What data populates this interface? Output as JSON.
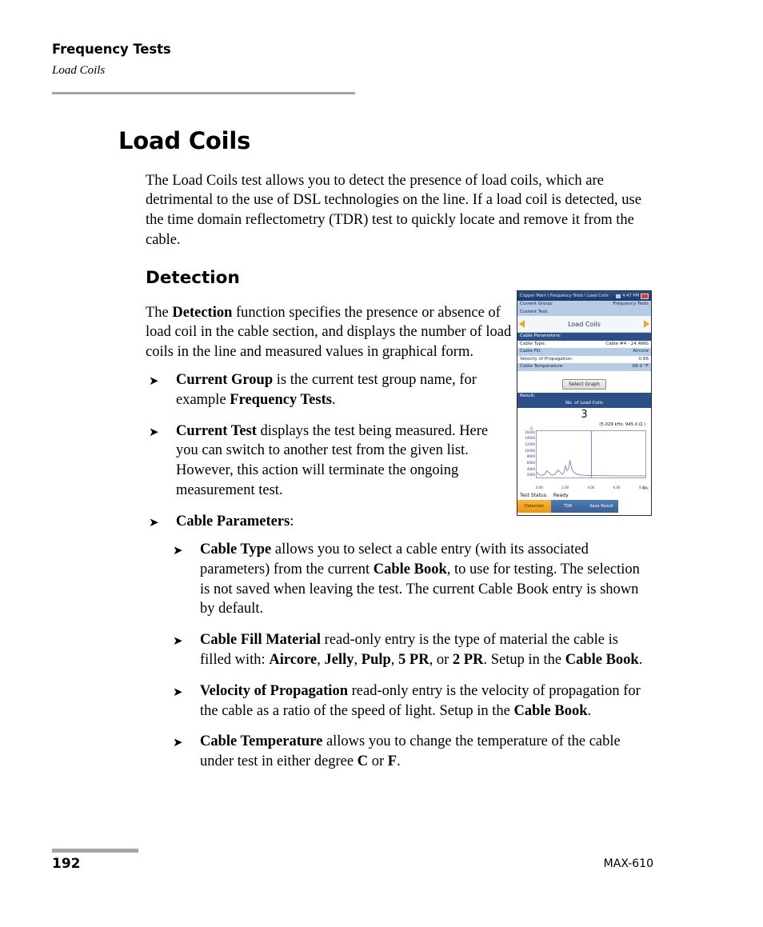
{
  "header": {
    "chapter": "Frequency Tests",
    "section": "Load Coils"
  },
  "title": "Load Coils",
  "intro": "The Load Coils test allows you to detect the presence of load coils, which are detrimental to the use of DSL technologies on the line. If a load coil is detected, use the time domain reflectometry (TDR) test to quickly locate and remove it from the cable.",
  "detection_heading": "Detection",
  "detection_para_html": "The <b>Detection</b> function specifies the presence or absence of load coil in the cable section, and displays the number of load coils in the line and measured values in graphical form.",
  "bullet_glyph": "➤",
  "bullets_level1": [
    "<b>Current Group</b> is the current test group name, for example <b>Frequency Tests</b>.",
    "<b>Current Test</b> displays the test being measured. Here you can switch to another test from the given list. However, this action will terminate the ongoing measurement test.",
    "<b>Cable Parameters</b>:"
  ],
  "bullets_level2": [
    "<b>Cable Type</b> allows you to select a cable entry (with its associated parameters) from the current <b>Cable Book</b>, to use for testing. The selection is not saved when leaving the test. The current Cable Book entry is shown by default.",
    "<b>Cable Fill Material</b> read-only entry is the type of material the cable is filled with: <b>Aircore</b>, <b>Jelly</b>, <b>Pulp</b>, <b>5 PR</b>, or <b>2 PR</b>. Setup in the <b>Cable Book</b>.",
    "<b>Velocity of Propagation</b> read-only entry is the velocity of propagation for the cable as a ratio of the speed of light. Setup in the <b>Cable Book</b>.",
    "<b>Cable Temperature</b> allows you to change the temperature of the cable under test in either degree <b>C</b> or <b>F</b>."
  ],
  "footer": {
    "page_number": "192",
    "model": "MAX-610"
  },
  "device": {
    "titlebar": {
      "breadcrumb": "Copper Main \\ Frequency Tests \\ Load Coils",
      "time": "4:47 PM"
    },
    "current_group_label": "Current Group:",
    "current_group_value": "Frequency Tests",
    "current_test_label": "Current Test:",
    "current_test_value": "Load Coils",
    "cable_parameters_label": "Cable Parameters:",
    "parameters": [
      {
        "label": "Cable Type:",
        "value": "Cable #4 - 24 AWG"
      },
      {
        "label": "Cable Fill:",
        "value": "Aircore"
      },
      {
        "label": "Velocity of Propagation:",
        "value": "0.66"
      },
      {
        "label": "Cable Temperature:",
        "value": "68.0 °F"
      }
    ],
    "select_graph_button": "Select Graph",
    "result_label": "Result:",
    "result_title": "No. of Load Coils",
    "coil_count": "3",
    "marker_readout": "(5.029 kHz, 945.0 Ω )",
    "test_status_label": "Test Status:",
    "test_status_value": "Ready",
    "softkeys": [
      {
        "label": "Detection",
        "state": "active"
      },
      {
        "label": "TDR",
        "state": "idle"
      },
      {
        "label": "Save Result",
        "state": "idle"
      }
    ],
    "colors": {
      "titlebar": "#2b4f86",
      "band": "#2b4f86",
      "row_alt": "#b6cbe4",
      "accent": "#f5a623",
      "softkey_active": "#ef9311",
      "softkey_idle": "#3a5f93"
    }
  },
  "chart_data": {
    "type": "line",
    "title": "No. of Load Coils",
    "xlabel": "kHz",
    "ylabel": "Ω",
    "xlim": [
      0,
      10
    ],
    "ylim": [
      0,
      17000
    ],
    "xticks": [
      "0.00",
      "2.00",
      "4.00",
      "6.00",
      "8.00"
    ],
    "yticks": [
      "16000",
      "14000",
      "12000",
      "10000",
      "8000",
      "6000",
      "4000",
      "2000"
    ],
    "grid": false,
    "legend": false,
    "marker": {
      "x": 5.029,
      "y": 945.0,
      "label": "(5.029 kHz, 945.0 Ω )"
    },
    "series": [
      {
        "name": "Impedance",
        "color": "#6b6b9c",
        "x": [
          0.0,
          0.15,
          0.35,
          0.55,
          0.75,
          0.95,
          1.15,
          1.3,
          1.45,
          1.6,
          1.75,
          1.95,
          2.15,
          2.35,
          2.5,
          2.65,
          2.8,
          2.95,
          3.05,
          3.15,
          3.25,
          3.4,
          3.6,
          3.85,
          4.1,
          4.4,
          4.8,
          5.2,
          5.6,
          6.0,
          6.5,
          7.0,
          7.5,
          8.0,
          8.5,
          9.0,
          9.5,
          10.0
        ],
        "y": [
          1900,
          1250,
          900,
          800,
          1200,
          2450,
          1700,
          1000,
          850,
          1100,
          1500,
          2750,
          2050,
          1150,
          1700,
          4200,
          2500,
          3400,
          6300,
          4600,
          2900,
          2000,
          1400,
          1050,
          880,
          800,
          740,
          700,
          670,
          650,
          630,
          615,
          600,
          595,
          590,
          585,
          580,
          575
        ]
      }
    ]
  }
}
